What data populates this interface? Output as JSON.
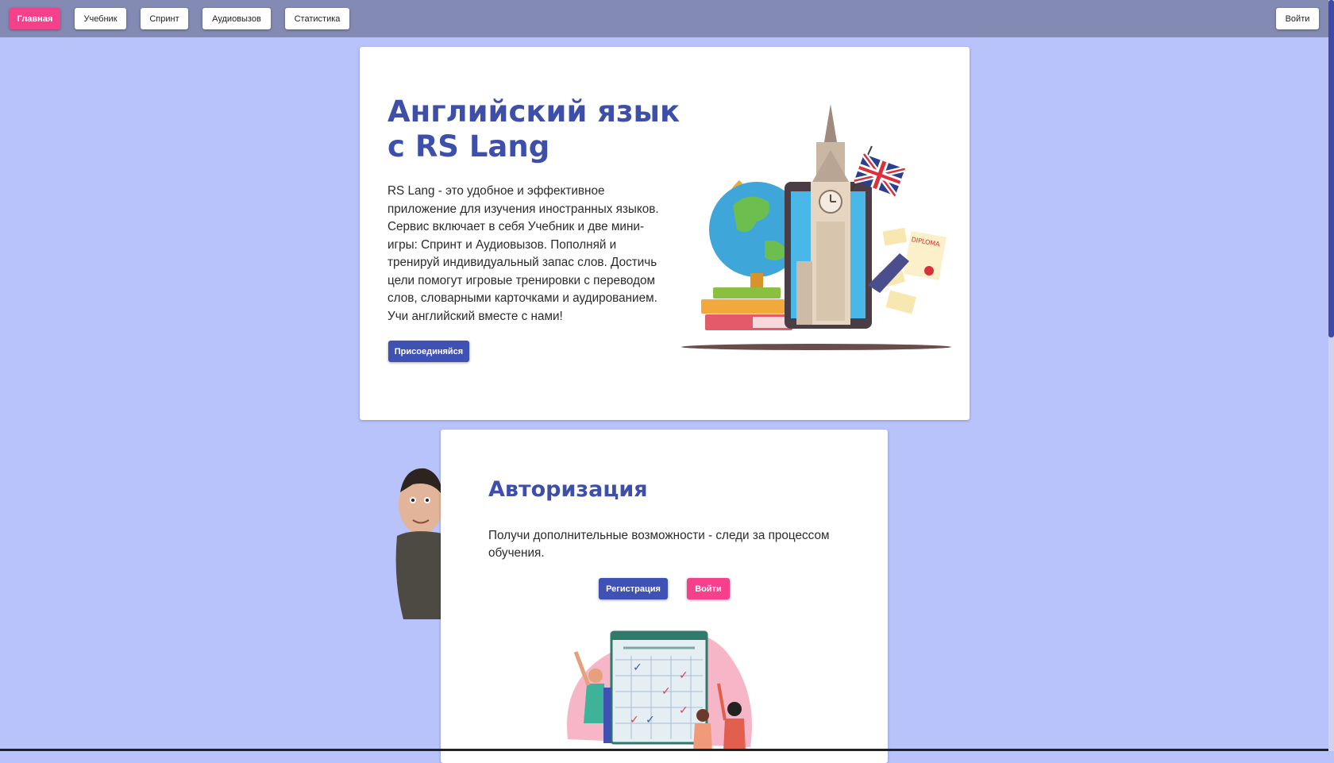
{
  "nav": {
    "items": [
      {
        "label": "Главная",
        "active": true
      },
      {
        "label": "Учебник",
        "active": false
      },
      {
        "label": "Спринт",
        "active": false
      },
      {
        "label": "Аудиовызов",
        "active": false
      },
      {
        "label": "Статистика",
        "active": false
      }
    ],
    "login_label": "Войти"
  },
  "hero": {
    "title": "Английский язык с RS Lang",
    "description": "RS Lang - это удобное и эффективное приложение для изучения иностранных языков. Сервис включает в себя Учебник и две мини-игры: Спринт и Аудиовызов. Пополняй и тренируй индивидуальный запас слов. Достичь цели помогут игровые тренировки с переводом слов, словарными карточками и аудированием. Учи английский вместе с нами!",
    "join_label": "Присоединяйся",
    "illustration_icon": "big-ben-globe-illustration",
    "diploma_text": "DIPLOMA"
  },
  "auth": {
    "title": "Авторизация",
    "description": "Получи дополнительные возможности - следи за процессом обучения.",
    "register_label": "Регистрация",
    "login_label": "Войти",
    "illustration_icon": "checklist-people-illustration"
  },
  "colors": {
    "background": "#b8c2fb",
    "topbar": "#838bb5",
    "primary": "#3f51b5",
    "accent": "#f5418b",
    "heading": "#3d4fa8"
  }
}
